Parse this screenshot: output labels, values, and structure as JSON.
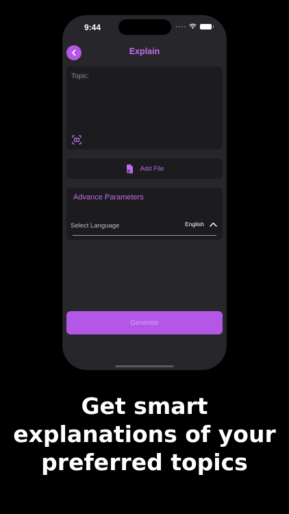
{
  "status_bar": {
    "time": "9:44"
  },
  "header": {
    "title": "Explain",
    "back_icon": "chevron-left-icon"
  },
  "topic": {
    "label": "Topic:",
    "value": "",
    "scan_icon": "scan-text-icon"
  },
  "add_file": {
    "label": "Add File",
    "icon": "file-add-icon"
  },
  "advanced": {
    "title": "Advance Parameters",
    "language_label": "Select Language",
    "language_value": "English",
    "chevron_icon": "chevron-up-icon"
  },
  "generate": {
    "label": "Generate"
  },
  "tagline": {
    "line1": "Get smart",
    "line2": "explanations of your",
    "line3": "preferred topics"
  },
  "colors": {
    "accent": "#b457e6",
    "accent_text": "#c06cf0",
    "background": "#000000",
    "phone_bg": "#27262b",
    "card_bg": "#1c1c1f"
  }
}
